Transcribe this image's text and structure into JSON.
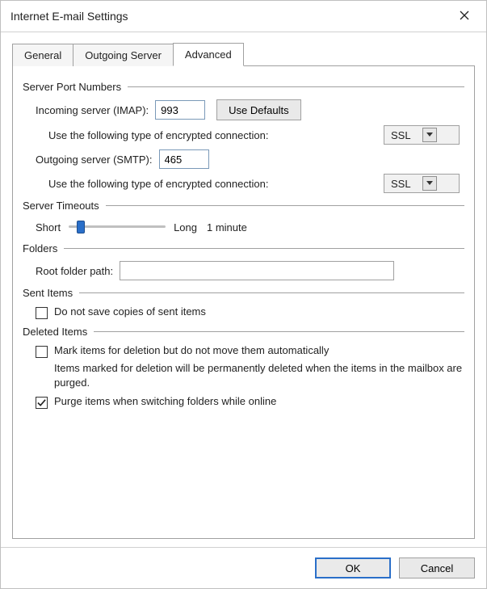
{
  "window": {
    "title": "Internet E-mail Settings"
  },
  "tabs": {
    "general": "General",
    "outgoing": "Outgoing Server",
    "advanced": "Advanced",
    "active": "advanced"
  },
  "serverPort": {
    "heading": "Server Port Numbers",
    "incomingLabel": "Incoming server (IMAP):",
    "incomingValue": "993",
    "useDefaults": "Use Defaults",
    "encryptionLabel": "Use the following type of encrypted connection:",
    "incomingEncryption": "SSL",
    "outgoingLabel": "Outgoing server (SMTP):",
    "outgoingValue": "465",
    "outgoingEncryption": "SSL"
  },
  "timeouts": {
    "heading": "Server Timeouts",
    "short": "Short",
    "long": "Long",
    "value": "1 minute",
    "sliderPercent": 8
  },
  "folders": {
    "heading": "Folders",
    "rootLabel": "Root folder path:",
    "rootValue": ""
  },
  "sentItems": {
    "heading": "Sent Items",
    "doNotSave": "Do not save copies of sent items",
    "doNotSaveChecked": false
  },
  "deletedItems": {
    "heading": "Deleted Items",
    "markLabel": "Mark items for deletion but do not move them automatically",
    "markChecked": false,
    "markHelp": "Items marked for deletion will be permanently deleted when the items in the mailbox are purged.",
    "purgeLabel": "Purge items when switching folders while online",
    "purgeChecked": true
  },
  "buttons": {
    "ok": "OK",
    "cancel": "Cancel"
  }
}
